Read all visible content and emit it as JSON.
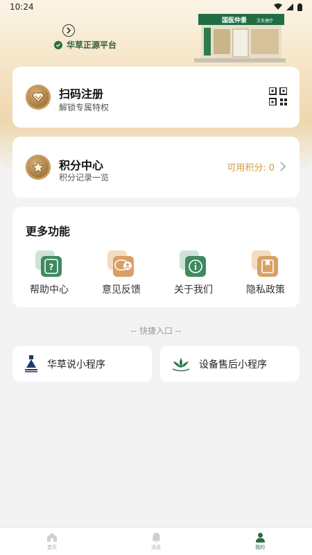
{
  "status_bar": {
    "time": "10:24"
  },
  "header": {
    "platform_label": "华草正源平台",
    "store_sign": "国医仲景",
    "store_sub": "艾灸理疗"
  },
  "scan_card": {
    "title": "扫码注册",
    "subtitle": "解锁专属特权"
  },
  "points_card": {
    "title": "积分中心",
    "subtitle": "积分记录一览",
    "available_label": "可用积分:",
    "available_value": "0"
  },
  "more": {
    "title": "更多功能",
    "items": [
      {
        "label": "帮助中心",
        "icon": "help-icon"
      },
      {
        "label": "意见反馈",
        "icon": "feedback-icon"
      },
      {
        "label": "关于我们",
        "icon": "about-icon"
      },
      {
        "label": "隐私政策",
        "icon": "privacy-icon"
      }
    ]
  },
  "shortcuts": {
    "label": "-- 快捷入口 --",
    "items": [
      {
        "label": "华草说小程序",
        "icon": "huacao-logo-icon"
      },
      {
        "label": "设备售后小程序",
        "icon": "lotus-icon"
      }
    ]
  },
  "tabbar": {
    "items": [
      {
        "label": "首页",
        "icon": "home-icon"
      },
      {
        "label": "消息",
        "icon": "bell-icon"
      },
      {
        "label": "我的",
        "icon": "user-icon"
      }
    ],
    "active_index": 2
  },
  "colors": {
    "accent_green": "#2d6c44",
    "gold": "#d59a3b"
  }
}
